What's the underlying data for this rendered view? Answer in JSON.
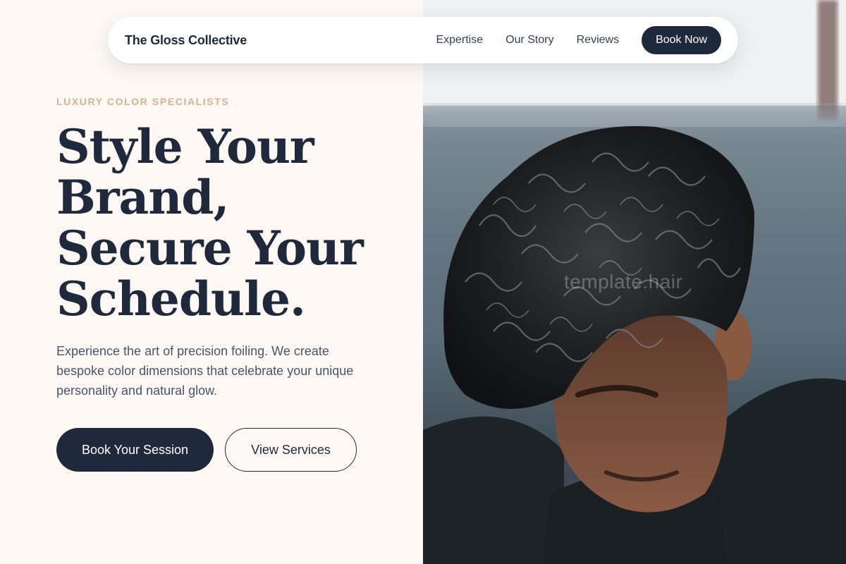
{
  "nav": {
    "brand": "The Gloss Collective",
    "links": [
      "Expertise",
      "Our Story",
      "Reviews"
    ],
    "cta": "Book Now"
  },
  "hero": {
    "eyebrow": "LUXURY COLOR SPECIALISTS",
    "headline_lines": [
      "Style Your",
      "Brand,",
      "Secure Your",
      "Schedule."
    ],
    "description": "Experience the art of precision foiling. We create bespoke color dimensions that celebrate your unique personality and natural glow.",
    "primary_button": "Book Your Session",
    "secondary_button": "View Services"
  },
  "photo": {
    "watermark": "template.hair"
  },
  "colors": {
    "background": "#fdf8f3",
    "navy": "#1e293b",
    "accent_gold": "#d4b48c",
    "body_text": "#475569"
  }
}
